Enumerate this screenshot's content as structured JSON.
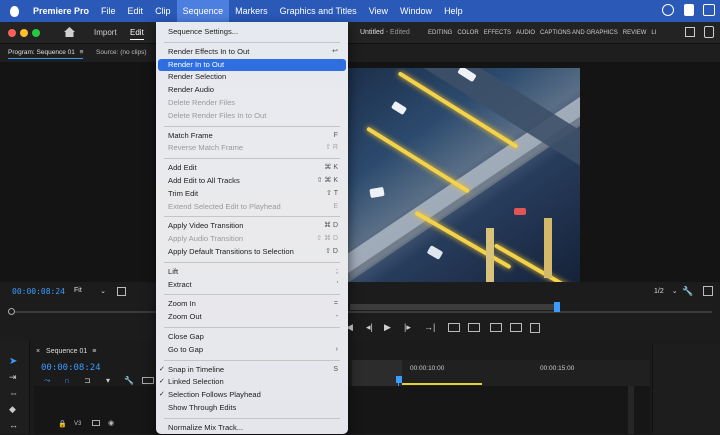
{
  "menubar": {
    "app": "Premiere Pro",
    "items": [
      "File",
      "Edit",
      "Clip",
      "Sequence",
      "Markers",
      "Graphics and Titles",
      "View",
      "Window",
      "Help"
    ],
    "active": "Sequence"
  },
  "titlebar": {
    "home_icon": "home-icon",
    "import": "Import",
    "edit": "Edit",
    "doc_title": "Untitled",
    "doc_status": "- Edited",
    "workspaces": [
      "EDITING",
      "COLOR",
      "EFFECTS",
      "AUDIO",
      "CAPTIONS AND GRAPHICS",
      "REVIEW",
      "LI"
    ]
  },
  "panels": {
    "program": "Program: Sequence 01",
    "program_menu": "≡",
    "source": "Source: (no clips)"
  },
  "monitor": {
    "timecode": "00:00:08:24",
    "fit": "Fit",
    "quality": "1/2"
  },
  "timeline": {
    "tab": "Sequence 01",
    "tab_menu": "≡",
    "timecode": "00:00:08:24",
    "ruler": [
      "00:00:10:00",
      "00:00:15:00"
    ],
    "track": "V3"
  },
  "sequence_menu": {
    "items": [
      {
        "label": "Sequence Settings...",
        "shortcut": "",
        "disabled": false
      },
      {
        "sep": true
      },
      {
        "label": "Render Effects In to Out",
        "shortcut": "↩",
        "disabled": false
      },
      {
        "label": "Render In to Out",
        "shortcut": "",
        "disabled": false,
        "highlighted": true
      },
      {
        "label": "Render Selection",
        "shortcut": "",
        "disabled": false
      },
      {
        "label": "Render Audio",
        "shortcut": "",
        "disabled": false
      },
      {
        "label": "Delete Render Files",
        "shortcut": "",
        "disabled": true
      },
      {
        "label": "Delete Render Files In to Out",
        "shortcut": "",
        "disabled": true
      },
      {
        "sep": true
      },
      {
        "label": "Match Frame",
        "shortcut": "F",
        "disabled": false
      },
      {
        "label": "Reverse Match Frame",
        "shortcut": "⇧ R",
        "disabled": true
      },
      {
        "sep": true
      },
      {
        "label": "Add Edit",
        "shortcut": "⌘ K",
        "disabled": false
      },
      {
        "label": "Add Edit to All Tracks",
        "shortcut": "⇧ ⌘ K",
        "disabled": false
      },
      {
        "label": "Trim Edit",
        "shortcut": "⇧ T",
        "disabled": false
      },
      {
        "label": "Extend Selected Edit to Playhead",
        "shortcut": "E",
        "disabled": true
      },
      {
        "sep": true
      },
      {
        "label": "Apply Video Transition",
        "shortcut": "⌘ D",
        "disabled": false
      },
      {
        "label": "Apply Audio Transition",
        "shortcut": "⇧ ⌘ D",
        "disabled": true
      },
      {
        "label": "Apply Default Transitions to Selection",
        "shortcut": "⇧ D",
        "disabled": false
      },
      {
        "sep": true
      },
      {
        "label": "Lift",
        "shortcut": ";",
        "disabled": false
      },
      {
        "label": "Extract",
        "shortcut": "'",
        "disabled": false
      },
      {
        "sep": true
      },
      {
        "label": "Zoom In",
        "shortcut": "=",
        "disabled": false
      },
      {
        "label": "Zoom Out",
        "shortcut": "-",
        "disabled": false
      },
      {
        "sep": true
      },
      {
        "label": "Close Gap",
        "shortcut": "",
        "disabled": false
      },
      {
        "label": "Go to Gap",
        "shortcut": "›",
        "disabled": false
      },
      {
        "sep": true
      },
      {
        "label": "Snap in Timeline",
        "shortcut": "S",
        "disabled": false,
        "checked": true
      },
      {
        "label": "Linked Selection",
        "shortcut": "",
        "disabled": false,
        "checked": true
      },
      {
        "label": "Selection Follows Playhead",
        "shortcut": "",
        "disabled": false,
        "checked": true
      },
      {
        "label": "Show Through Edits",
        "shortcut": "",
        "disabled": false
      },
      {
        "sep": true
      },
      {
        "label": "Normalize Mix Track...",
        "shortcut": "",
        "disabled": false
      }
    ]
  },
  "colors": {
    "menubar": "#2a59b8",
    "highlight": "#2f6ee0",
    "timecode": "#3b9bff"
  }
}
